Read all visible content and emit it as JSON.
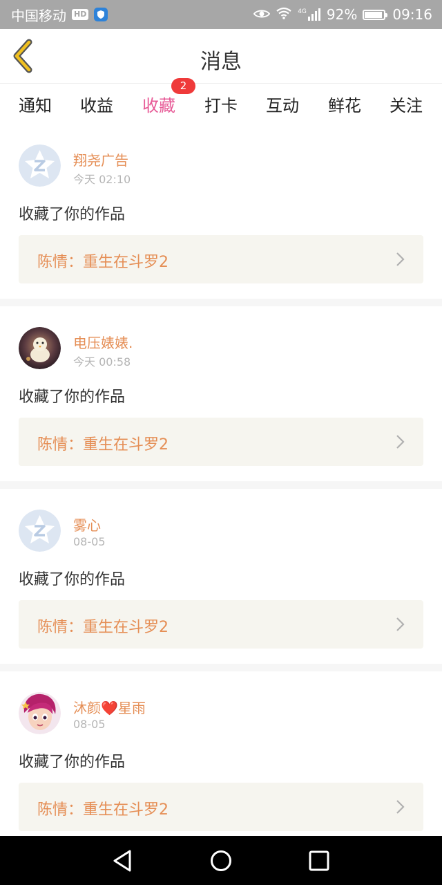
{
  "status_bar": {
    "carrier": "中国移动",
    "hd_badge": "HD",
    "network": "4G",
    "battery": "92%",
    "battery_level": 0.92,
    "time": "09:16"
  },
  "header": {
    "title": "消息"
  },
  "tabs": [
    {
      "label": "通知"
    },
    {
      "label": "收益"
    },
    {
      "label": "收藏",
      "badge": "2",
      "active": true
    },
    {
      "label": "打卡"
    },
    {
      "label": "互动"
    },
    {
      "label": "鲜花"
    },
    {
      "label": "关注"
    }
  ],
  "messages": [
    {
      "user": "翔尧广告",
      "time": "今天 02:10",
      "action": "收藏了你的作品",
      "work": "陈情：重生在斗罗2",
      "avatar": "default-avatar-icon"
    },
    {
      "user": "电压婊婊.",
      "time": "今天 00:58",
      "action": "收藏了你的作品",
      "work": "陈情：重生在斗罗2",
      "avatar": "chick-photo-avatar"
    },
    {
      "user": "雾心",
      "time": "08-05",
      "action": "收藏了你的作品",
      "work": "陈情：重生在斗罗2",
      "avatar": "default-avatar-icon"
    },
    {
      "user": "沐颜❤️星雨",
      "time": "08-05",
      "action": "收藏了你的作品",
      "work": "陈情：重生在斗罗2",
      "avatar": "cartoon-girl-avatar"
    }
  ],
  "colors": {
    "accent_pink": "#e75b97",
    "name_orange": "#e58e55",
    "back_arrow": "#f0c020",
    "badge_red": "#ef3a3a"
  }
}
